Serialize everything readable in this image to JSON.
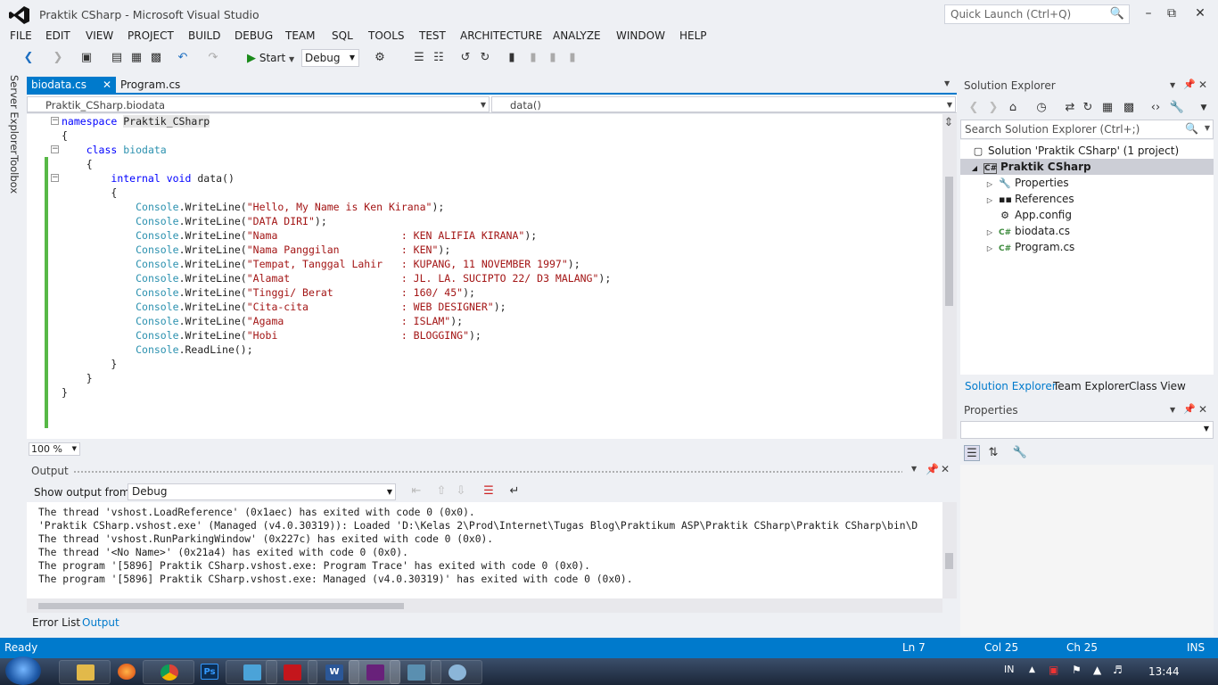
{
  "window": {
    "title": "Praktik CSharp - Microsoft Visual Studio"
  },
  "quick_launch": {
    "placeholder": "Quick Launch (Ctrl+Q)"
  },
  "menu": [
    "FILE",
    "EDIT",
    "VIEW",
    "PROJECT",
    "BUILD",
    "DEBUG",
    "TEAM",
    "SQL",
    "TOOLS",
    "TEST",
    "ARCHITECTURE",
    "ANALYZE",
    "WINDOW",
    "HELP"
  ],
  "toolbar": {
    "start_label": "Start",
    "config": "Debug"
  },
  "side_tabs": {
    "server_explorer": "Server Explorer",
    "toolbox": "Toolbox"
  },
  "editor_tabs": [
    {
      "label": "biodata.cs",
      "active": true
    },
    {
      "label": "Program.cs",
      "active": false
    }
  ],
  "nav": {
    "type": "Praktik_CSharp.biodata",
    "member": "data()"
  },
  "code": {
    "namespace_kw": "namespace",
    "namespace_name": "Praktik_CSharp",
    "class_kw": "class",
    "class_name": "biodata",
    "method_mods": "internal void",
    "method_name": "data()",
    "type": "Console",
    "lines": [
      {
        "call": "WriteLine(",
        "arg": "\"Hello, My Name is Ken Kirana\"",
        "end": ");"
      },
      {
        "call": "WriteLine(",
        "arg": "\"DATA DIRI\"",
        "end": ");"
      },
      {
        "call": "WriteLine(",
        "arg": "\"Nama                    : KEN ALIFIA KIRANA\"",
        "end": ");"
      },
      {
        "call": "WriteLine(",
        "arg": "\"Nama Panggilan          : KEN\"",
        "end": ");"
      },
      {
        "call": "WriteLine(",
        "arg": "\"Tempat, Tanggal Lahir   : KUPANG, 11 NOVEMBER 1997\"",
        "end": ");"
      },
      {
        "call": "WriteLine(",
        "arg": "\"Alamat                  : JL. LA. SUCIPTO 22/ D3 MALANG\"",
        "end": ");"
      },
      {
        "call": "WriteLine(",
        "arg": "\"Tinggi/ Berat           : 160/ 45\"",
        "end": ");"
      },
      {
        "call": "WriteLine(",
        "arg": "\"Cita-cita               : WEB DESIGNER\"",
        "end": ");"
      },
      {
        "call": "WriteLine(",
        "arg": "\"Agama                   : ISLAM\"",
        "end": ");"
      },
      {
        "call": "WriteLine(",
        "arg": "\"Hobi                    : BLOGGING\"",
        "end": ");"
      }
    ],
    "readline": "ReadLine();"
  },
  "zoom": "100 %",
  "output": {
    "title": "Output",
    "show_from_label": "Show output from:",
    "source": "Debug",
    "lines": [
      "The thread 'vshost.LoadReference' (0x1aec) has exited with code 0 (0x0).",
      "'Praktik CSharp.vshost.exe' (Managed (v4.0.30319)): Loaded 'D:\\Kelas 2\\Prod\\Internet\\Tugas Blog\\Praktikum ASP\\Praktik CSharp\\Praktik CSharp\\bin\\D",
      "The thread 'vshost.RunParkingWindow' (0x227c) has exited with code 0 (0x0).",
      "The thread '<No Name>' (0x21a4) has exited with code 0 (0x0).",
      "The program '[5896] Praktik CSharp.vshost.exe: Program Trace' has exited with code 0 (0x0).",
      "The program '[5896] Praktik CSharp.vshost.exe: Managed (v4.0.30319)' has exited with code 0 (0x0)."
    ]
  },
  "bottom_tabs": [
    {
      "label": "Error List"
    },
    {
      "label": "Output",
      "active": true
    }
  ],
  "solution_explorer": {
    "title": "Solution Explorer",
    "search_placeholder": "Search Solution Explorer (Ctrl+;)",
    "tree": [
      {
        "label": "Solution 'Praktik CSharp' (1 project)",
        "icon": "solution-icon",
        "indent": 0
      },
      {
        "label": "Praktik CSharp",
        "icon": "csharp-project-icon",
        "indent": 1,
        "selected": true
      },
      {
        "label": "Properties",
        "icon": "wrench-icon",
        "indent": 2
      },
      {
        "label": "References",
        "icon": "references-icon",
        "indent": 2
      },
      {
        "label": "App.config",
        "icon": "config-file-icon",
        "indent": 2
      },
      {
        "label": "biodata.cs",
        "icon": "csharp-file-icon",
        "indent": 2
      },
      {
        "label": "Program.cs",
        "icon": "csharp-file-icon",
        "indent": 2
      }
    ],
    "tabs": [
      "Solution Explorer",
      "Team Explorer",
      "Class View"
    ]
  },
  "properties": {
    "title": "Properties"
  },
  "status": {
    "text": "Ready",
    "ln": "Ln 7",
    "col": "Col 25",
    "ch": "Ch 25",
    "mode": "INS"
  },
  "taskbar": {
    "lang": "IN",
    "time": "13:44"
  },
  "colors": {
    "accent": "#007acc",
    "keyword": "#0000ff",
    "type": "#2b91af",
    "string": "#a31515",
    "changed_line": "#57b846"
  }
}
